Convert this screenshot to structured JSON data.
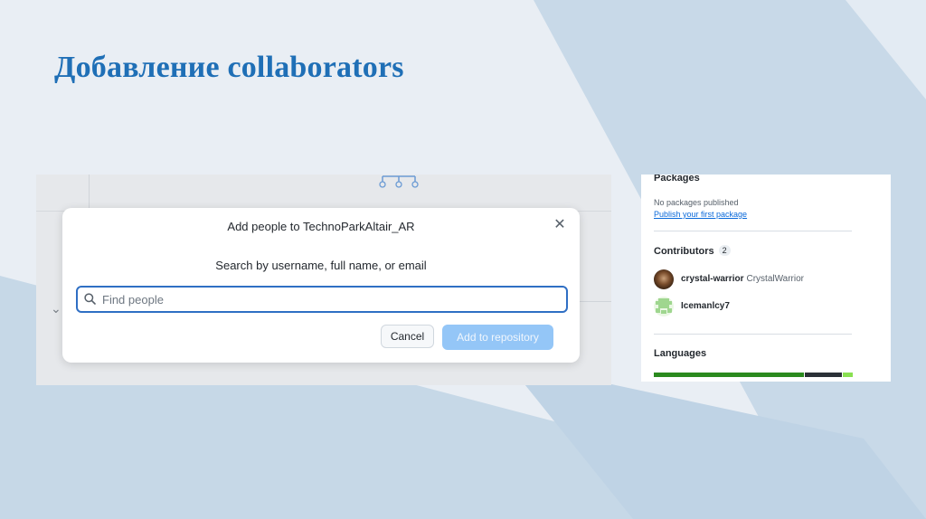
{
  "slide": {
    "title": "Добавление collaborators"
  },
  "modal": {
    "title": "Add people to TechnoParkAltair_AR",
    "subtitle": "Search by username, full name, or email",
    "search_placeholder": "Find people",
    "search_value": "",
    "cancel_label": "Cancel",
    "add_label": "Add to repository",
    "close_icon": "close-icon"
  },
  "sidebar": {
    "packages": {
      "heading": "Packages",
      "empty_text": "No packages published",
      "link_text": "Publish your first package"
    },
    "contributors": {
      "heading": "Contributors",
      "count": "2",
      "items": [
        {
          "login": "crystal-warrior",
          "name": "CrystalWarrior"
        },
        {
          "login": "Icemanlcy7",
          "name": ""
        }
      ]
    },
    "languages": {
      "heading": "Languages",
      "bar_shares": [
        0.76,
        0.19,
        0.05
      ],
      "bar_colors": [
        "#2b8a1e",
        "#2b3137",
        "#89e051"
      ]
    }
  },
  "colors": {
    "title": "#1f6fb6",
    "primary_button_disabled": "#94c6f7",
    "search_focus": "#2f6fc4",
    "link": "#0969da"
  }
}
